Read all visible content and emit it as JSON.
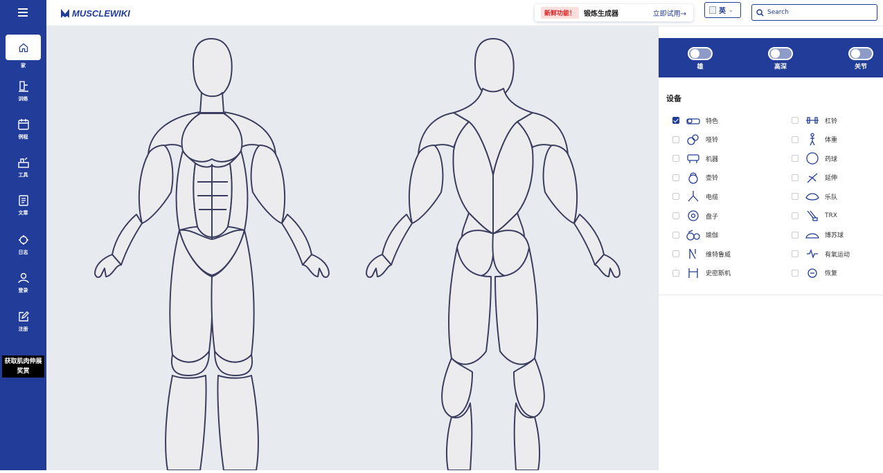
{
  "sidebar": {
    "items": [
      {
        "label": "家",
        "icon": "home-icon"
      },
      {
        "label": "训练",
        "icon": "workout-icon"
      },
      {
        "label": "例程",
        "icon": "calendar-icon"
      },
      {
        "label": "工具",
        "icon": "tools-icon"
      },
      {
        "label": "文章",
        "icon": "article-icon"
      },
      {
        "label": "日志",
        "icon": "log-icon"
      },
      {
        "label": "登录",
        "icon": "user-icon"
      },
      {
        "label": "注册",
        "icon": "edit-icon"
      }
    ],
    "promo_line1": "获取肌肉伸展",
    "promo_line2": "奖赏"
  },
  "header": {
    "logo_text": "MUSCLEWIKI",
    "banner_badge": "新鲜功能！",
    "banner_text": "锻炼生成器",
    "banner_cta": "立即试用→",
    "language": "英",
    "search_placeholder": "Search"
  },
  "toggles": [
    {
      "label": "雄"
    },
    {
      "label": "高深"
    },
    {
      "label": "关节"
    }
  ],
  "equipment": {
    "title": "设备",
    "items": [
      {
        "label": "特色",
        "checked": true,
        "icon": "featured-icon"
      },
      {
        "label": "杠铃",
        "checked": false,
        "icon": "barbell-icon"
      },
      {
        "label": "哑铃",
        "checked": false,
        "icon": "dumbbell-icon"
      },
      {
        "label": "体重",
        "checked": false,
        "icon": "bodyweight-icon"
      },
      {
        "label": "机器",
        "checked": false,
        "icon": "machine-icon"
      },
      {
        "label": "药球",
        "checked": false,
        "icon": "medicine-ball-icon"
      },
      {
        "label": "壶铃",
        "checked": false,
        "icon": "kettlebell-icon"
      },
      {
        "label": "延伸",
        "checked": false,
        "icon": "stretch-icon"
      },
      {
        "label": "电缆",
        "checked": false,
        "icon": "cable-icon"
      },
      {
        "label": "乐队",
        "checked": false,
        "icon": "band-icon"
      },
      {
        "label": "盘子",
        "checked": false,
        "icon": "plate-icon"
      },
      {
        "label": "TRX",
        "checked": false,
        "icon": "trx-icon"
      },
      {
        "label": "瑜伽",
        "checked": false,
        "icon": "yoga-icon"
      },
      {
        "label": "博苏球",
        "checked": false,
        "icon": "bosu-ball-icon"
      },
      {
        "label": "维特鲁威",
        "checked": false,
        "icon": "vitruvian-icon"
      },
      {
        "label": "有氧运动",
        "checked": false,
        "icon": "cardio-icon"
      },
      {
        "label": "史密斯机",
        "checked": false,
        "icon": "smith-machine-icon"
      },
      {
        "label": "恢复",
        "checked": false,
        "icon": "recovery-icon"
      }
    ]
  }
}
